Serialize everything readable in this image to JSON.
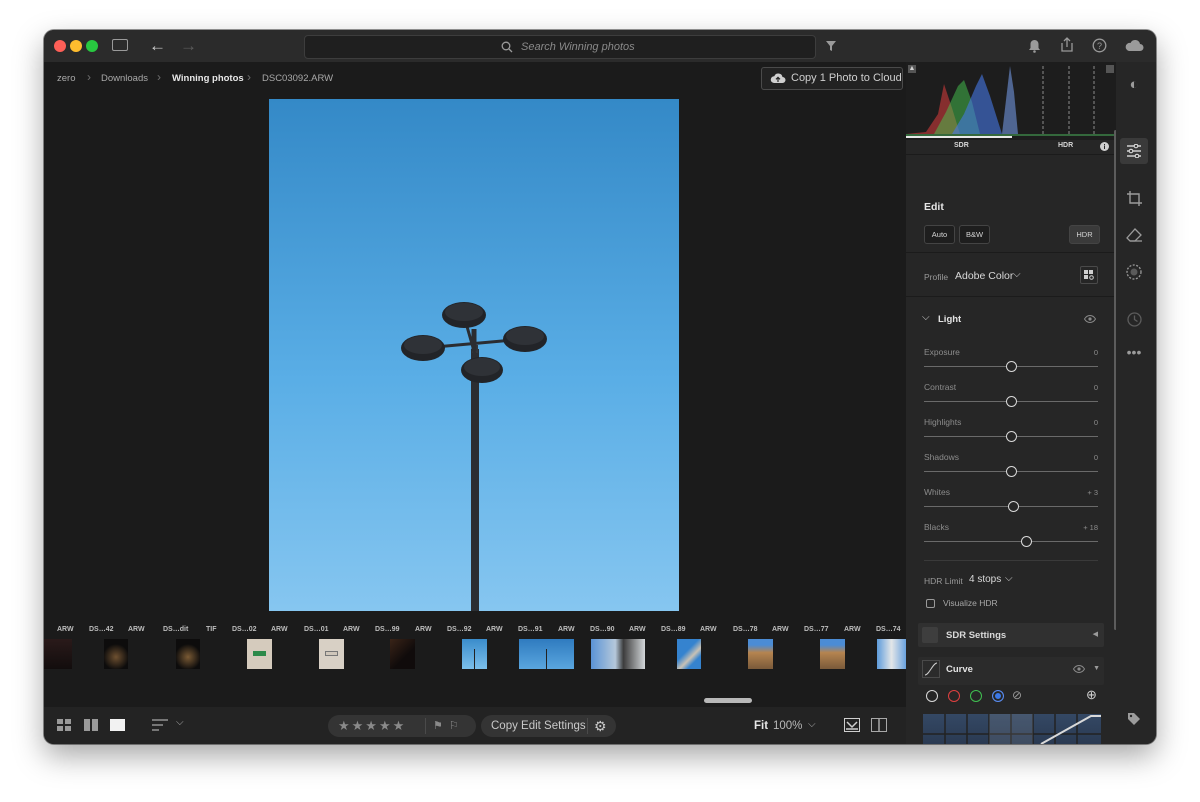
{
  "search": {
    "placeholder": "Search Winning photos"
  },
  "breadcrumb": [
    "zero",
    "Downloads",
    "Winning photos",
    "DSC03092.ARW"
  ],
  "cloud_button": "Copy 1 Photo to Cloud",
  "filmstrip": {
    "labels": [
      "ARW",
      "DS…42",
      "ARW",
      "DS…dit",
      "TIF",
      "DS…02",
      "ARW",
      "DS…01",
      "ARW",
      "DS…99",
      "ARW",
      "DS…92",
      "ARW",
      "DS…91",
      "ARW",
      "DS…90",
      "ARW",
      "DS…89",
      "ARW",
      "DS…78",
      "ARW",
      "DS…77",
      "ARW",
      "DS…74"
    ]
  },
  "bottombar": {
    "copy_edit": "Copy Edit Settings",
    "fit": "Fit",
    "zoom": "100%"
  },
  "histogram": {
    "sdr": "SDR",
    "hdr": "HDR"
  },
  "edit": {
    "title": "Edit",
    "auto": "Auto",
    "bw": "B&W",
    "hdr": "HDR",
    "profile_label": "Profile",
    "profile_value": "Adobe Color"
  },
  "light": {
    "title": "Light",
    "sliders": [
      {
        "label": "Exposure",
        "value": "0",
        "level": 0.5
      },
      {
        "label": "Contrast",
        "value": "0",
        "level": 0.5
      },
      {
        "label": "Highlights",
        "value": "0",
        "level": 0.5
      },
      {
        "label": "Shadows",
        "value": "0",
        "level": 0.5
      },
      {
        "label": "Whites",
        "value": "+ 3",
        "level": 0.515
      },
      {
        "label": "Blacks",
        "value": "+ 18",
        "level": 0.59
      }
    ],
    "hdr_limit_label": "HDR Limit",
    "hdr_limit_value": "4 stops",
    "visualize_hdr": "Visualize HDR"
  },
  "sdr_settings": "SDR Settings",
  "curve": {
    "title": "Curve"
  },
  "colors": {
    "accent": "#3b78e7",
    "panel": "#262626",
    "background": "#1b1b1b"
  }
}
